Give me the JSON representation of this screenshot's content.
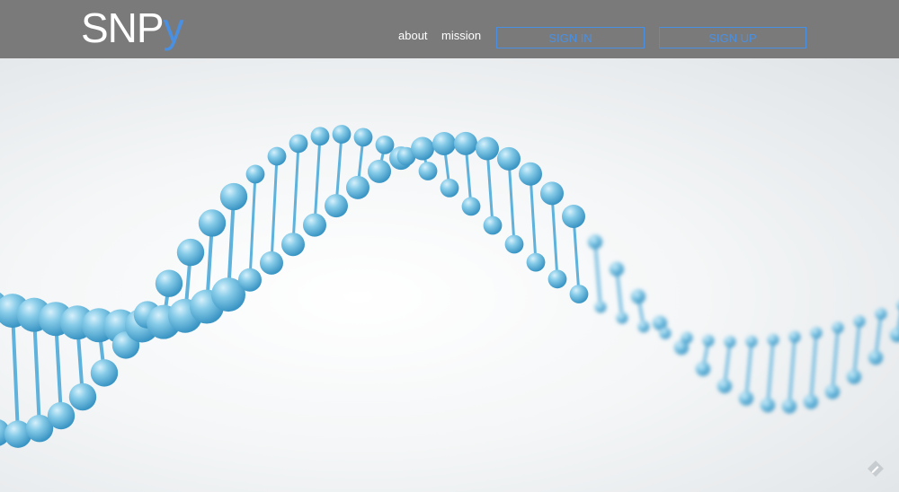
{
  "header": {
    "logo_main": "SNP",
    "logo_accent": "y",
    "nav": {
      "about": "about",
      "mission": "mission"
    },
    "buttons": {
      "signin": "SIGN IN",
      "signup": "SIGN UP"
    }
  },
  "hero": {
    "image": "dna-double-helix",
    "accent_color": "#4a90e2"
  },
  "badge_icon": "pencil-icon"
}
